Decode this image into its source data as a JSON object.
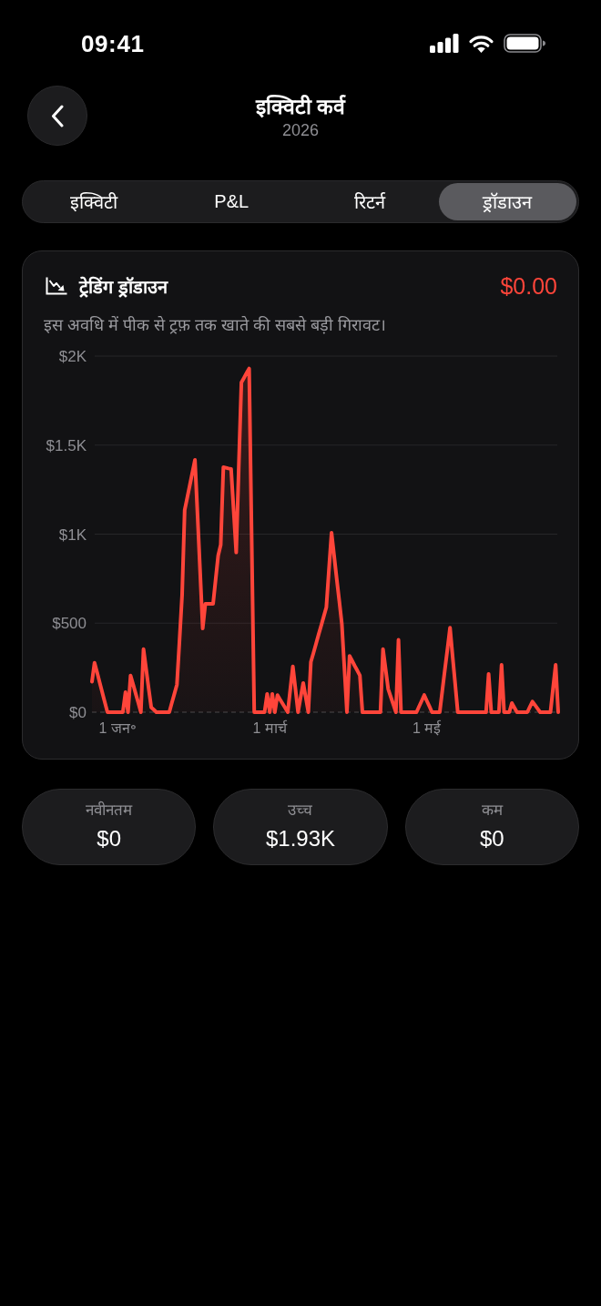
{
  "status_bar": {
    "time": "09:41"
  },
  "header": {
    "title": "इक्विटी कर्व",
    "subtitle": "2026"
  },
  "tabs": [
    {
      "label": "इक्विटी",
      "selected": false
    },
    {
      "label": "P&L",
      "selected": false
    },
    {
      "label": "रिटर्न",
      "selected": false
    },
    {
      "label": "ड्रॉडाउन",
      "selected": true
    }
  ],
  "drawdown_card": {
    "title": "ट्रेडिंग ड्रॉडाउन",
    "value": "$0.00",
    "description": "इस अवधि में पीक से ट्रफ़ तक खाते की सबसे बड़ी गिरावट।",
    "chart_data": {
      "type": "area",
      "grid": true,
      "categories": [
        null,
        null,
        null,
        null,
        null,
        null,
        null,
        null,
        null,
        null,
        "1 जन॰",
        null,
        null,
        null,
        null,
        null,
        null,
        null,
        null,
        null,
        null,
        null,
        null,
        null,
        null,
        null,
        null,
        null,
        null,
        null,
        null,
        null,
        null,
        null,
        null,
        null,
        null,
        null,
        null,
        null,
        null,
        null,
        null,
        null,
        null,
        null,
        null,
        null,
        null,
        null,
        null,
        null,
        null,
        null,
        null,
        null,
        null,
        null,
        null,
        null,
        null,
        null,
        null,
        null,
        null,
        null,
        null,
        null,
        null,
        "1 मार्च",
        null,
        null,
        null,
        null,
        null,
        null,
        null,
        null,
        null,
        null,
        null,
        null,
        null,
        null,
        null,
        null,
        null,
        null,
        null,
        null,
        null,
        null,
        null,
        null,
        null,
        null,
        null,
        null,
        null,
        null,
        null,
        null,
        null,
        null,
        null,
        null,
        null,
        null,
        null,
        null,
        null,
        null,
        null,
        null,
        null,
        null,
        null,
        null,
        null,
        null,
        null,
        null,
        null,
        null,
        null,
        null,
        null,
        null,
        null,
        null,
        "1 मई",
        null,
        null,
        null,
        null,
        null,
        null,
        null,
        null,
        null,
        null,
        null,
        null,
        null,
        null,
        null,
        null,
        null,
        null,
        null,
        null,
        null,
        null,
        null,
        null,
        null,
        null,
        null,
        null,
        null,
        null,
        null,
        null,
        null,
        null,
        null,
        null,
        null,
        null,
        null,
        null,
        null,
        null,
        null,
        null,
        null,
        null,
        null,
        null,
        null,
        null,
        null
      ],
      "series": [
        {
          "color": "#ff453a",
          "values": [
            172,
            278,
            222,
            167,
            111,
            56,
            0,
            0,
            0,
            0,
            0,
            0,
            0,
            112,
            0,
            206,
            155,
            103,
            52,
            0,
            354,
            245,
            136,
            27,
            14,
            0,
            0,
            0,
            0,
            0,
            0,
            52,
            103,
            155,
            408,
            660,
            1135,
            1206,
            1276,
            1347,
            1417,
            1101,
            786,
            470,
            608,
            608,
            608,
            608,
            744,
            880,
            940,
            1376,
            1373,
            1369,
            1366,
            1132,
            897,
            1375,
            1852,
            1878,
            1904,
            1930,
            965,
            0,
            0,
            0,
            0,
            0,
            103,
            0,
            103,
            0,
            96,
            72,
            48,
            24,
            0,
            129,
            257,
            129,
            0,
            82,
            164,
            82,
            0,
            283,
            334,
            385,
            437,
            488,
            539,
            590,
            799,
            1008,
            880,
            752,
            624,
            496,
            248,
            0,
            316,
            289,
            261,
            234,
            206,
            0,
            0,
            0,
            0,
            0,
            0,
            0,
            0,
            354,
            242,
            130,
            87,
            43,
            0,
            406,
            0,
            0,
            0,
            0,
            0,
            0,
            0,
            32,
            64,
            96,
            64,
            32,
            0,
            0,
            0,
            0,
            119,
            237,
            356,
            474,
            316,
            158,
            0,
            0,
            0,
            0,
            0,
            0,
            0,
            0,
            0,
            0,
            0,
            0,
            215,
            0,
            0,
            0,
            0,
            266,
            0,
            0,
            0,
            51,
            26,
            0,
            0,
            0,
            0,
            0,
            30,
            60,
            40,
            20,
            0,
            0,
            0,
            0,
            0,
            133,
            266,
            0
          ]
        }
      ],
      "ylim": [
        0,
        2000
      ],
      "yticks": [
        {
          "value": 0,
          "label": "$0"
        },
        {
          "value": 500,
          "label": "$500"
        },
        {
          "value": 1000,
          "label": "$1K"
        },
        {
          "value": 1500,
          "label": "$1.5K"
        },
        {
          "value": 2000,
          "label": "$2K"
        }
      ]
    }
  },
  "stats": [
    {
      "label": "नवीनतम",
      "value": "$0"
    },
    {
      "label": "उच्च",
      "value": "$1.93K"
    },
    {
      "label": "कम",
      "value": "$0"
    }
  ]
}
